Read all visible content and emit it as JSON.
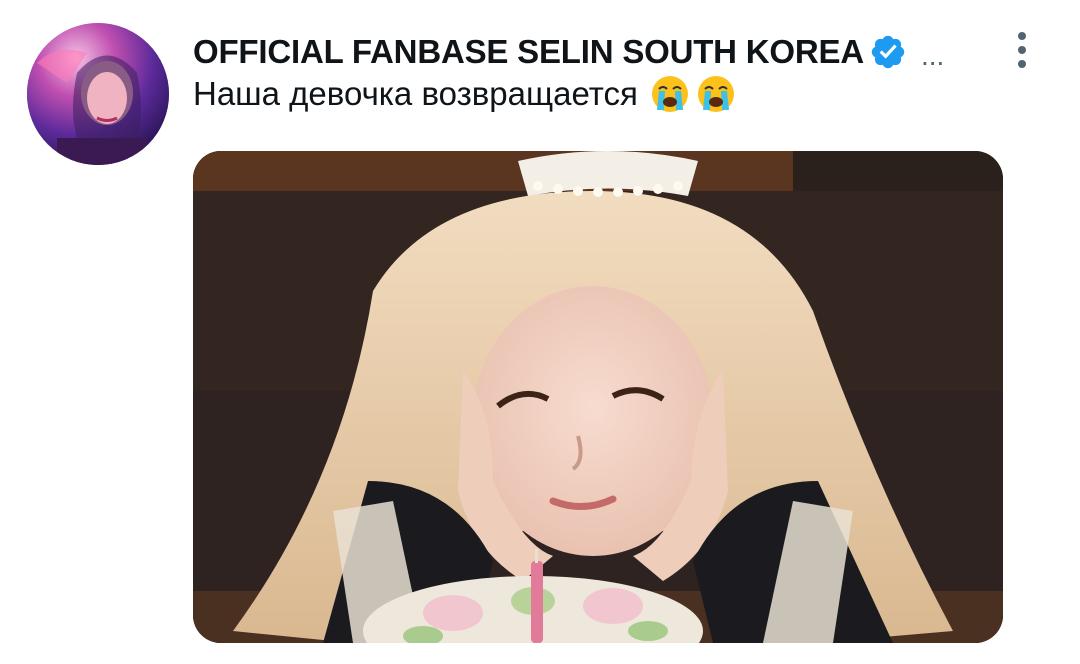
{
  "tweet": {
    "author_name": "OFFICIAL FANBASE SELIN SOUTH KOREA",
    "handle_truncated": "...",
    "text": "Наша девочка возвращается",
    "emojis": [
      "loudly-crying-face",
      "loudly-crying-face"
    ],
    "verified": true
  },
  "icons": {
    "verified": "verified-badge-icon",
    "more": "more-options-icon"
  },
  "colors": {
    "verified_blue": "#1d9bf0",
    "text_primary": "#0f1419",
    "text_secondary": "#536471"
  }
}
